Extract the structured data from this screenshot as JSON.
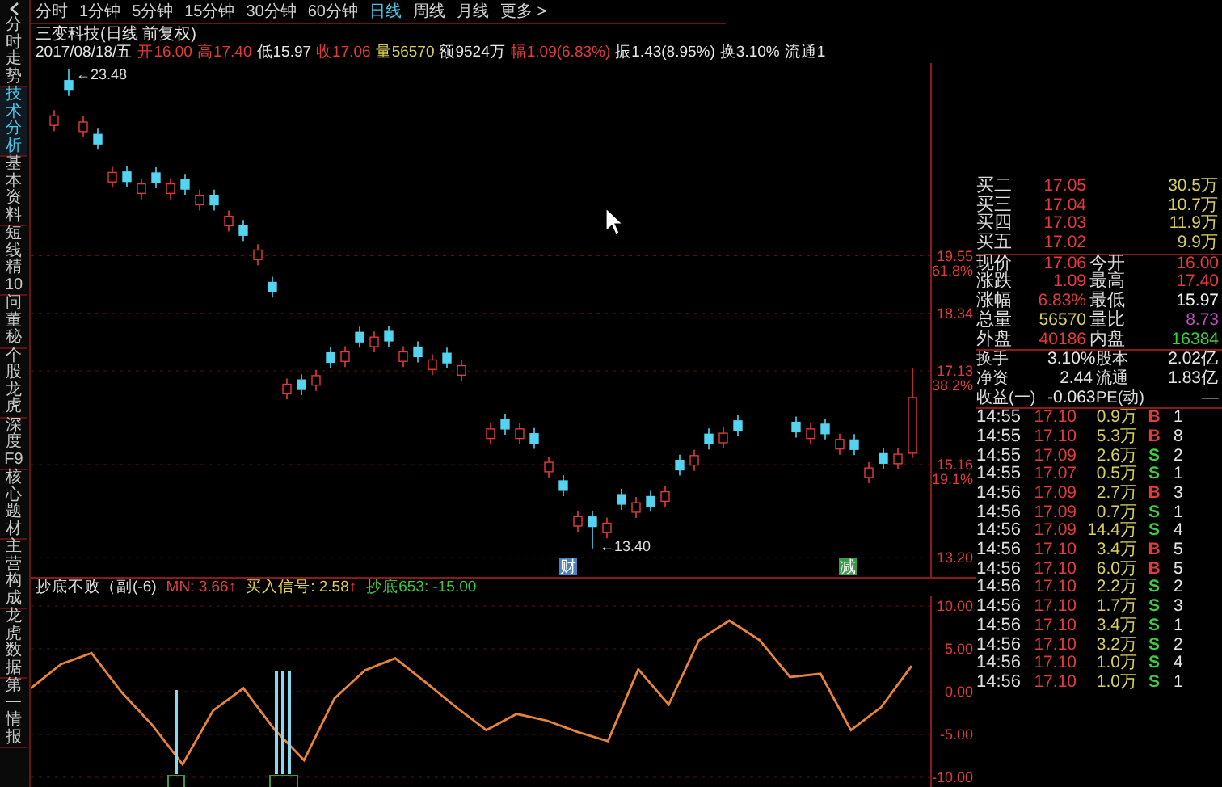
{
  "sidebar": [
    {
      "label": "分时走势",
      "selected": false
    },
    {
      "label": "技术分析",
      "selected": true
    },
    {
      "label": "基本资料",
      "selected": false
    },
    {
      "label": "短线精10",
      "selected": false
    },
    {
      "label": "问董秘",
      "selected": false
    },
    {
      "label": "个股龙虎",
      "selected": false
    },
    {
      "label": "深度F9",
      "selected": false
    },
    {
      "label": "核心题材",
      "selected": false
    },
    {
      "label": "主营构成",
      "selected": false
    },
    {
      "label": "龙虎数据",
      "selected": false
    },
    {
      "label": "第一情报",
      "selected": false
    }
  ],
  "periods": [
    {
      "label": "分时",
      "selected": false
    },
    {
      "label": "1分钟",
      "selected": false
    },
    {
      "label": "5分钟",
      "selected": false
    },
    {
      "label": "15分钟",
      "selected": false
    },
    {
      "label": "30分钟",
      "selected": false
    },
    {
      "label": "60分钟",
      "selected": false
    },
    {
      "label": "日线",
      "selected": true
    },
    {
      "label": "周线",
      "selected": false
    },
    {
      "label": "月线",
      "selected": false
    },
    {
      "label": "更多 >",
      "selected": false
    }
  ],
  "stock": {
    "title": "三变科技(日线 前复权)",
    "fields": [
      {
        "text": "2017/08/18/五",
        "color": "#e6e6e6"
      },
      {
        "text": "开16.00",
        "color": "#e23b3b"
      },
      {
        "text": "高17.40",
        "color": "#e23b3b"
      },
      {
        "text": "低15.97",
        "color": "#e6e6e6"
      },
      {
        "text": "收17.06",
        "color": "#e23b3b"
      },
      {
        "text": "量56570",
        "color": "#d8d05a"
      },
      {
        "text": "额9524万",
        "color": "#e6e6e6"
      },
      {
        "text": "幅1.09(6.83%)",
        "color": "#e23b3b"
      },
      {
        "text": "振1.43(8.95%)",
        "color": "#e6e6e6"
      },
      {
        "text": "换3.10%",
        "color": "#e6e6e6"
      },
      {
        "text": "流通1",
        "color": "#e6e6e6"
      }
    ]
  },
  "price_chart": {
    "fib_ratios": [
      "61.8%",
      "38.2%",
      "19.1%"
    ],
    "chart_data": {
      "type": "candlestick",
      "grid": true,
      "ylim": [
        12.8,
        23.6
      ],
      "yticks": [
        {
          "value": 19.55,
          "label": "19.55"
        },
        {
          "value": 18.34,
          "label": "18.34"
        },
        {
          "value": 17.13,
          "label": "17.13"
        },
        {
          "value": 15.16,
          "label": "15.16"
        },
        {
          "value": 13.2,
          "label": "13.20"
        }
      ],
      "ohlc": [
        [
          22.29,
          22.61,
          22.17,
          22.49
        ],
        [
          23.23,
          23.48,
          22.91,
          23.03
        ],
        [
          22.16,
          22.48,
          22.04,
          22.36
        ],
        [
          22.1,
          22.22,
          21.78,
          21.9
        ],
        [
          21.1,
          21.42,
          20.98,
          21.3
        ],
        [
          21.31,
          21.43,
          20.99,
          21.11
        ],
        [
          20.86,
          21.18,
          20.74,
          21.06
        ],
        [
          21.29,
          21.41,
          20.97,
          21.09
        ],
        [
          20.86,
          21.18,
          20.74,
          21.06
        ],
        [
          21.15,
          21.27,
          20.83,
          20.95
        ],
        [
          20.62,
          20.94,
          20.5,
          20.82
        ],
        [
          20.82,
          20.94,
          20.5,
          20.62
        ],
        [
          20.18,
          20.5,
          20.06,
          20.38
        ],
        [
          20.18,
          20.3,
          19.86,
          19.98
        ],
        [
          19.47,
          19.79,
          19.35,
          19.67
        ],
        [
          18.99,
          19.11,
          18.67,
          18.79
        ],
        [
          16.65,
          16.97,
          16.53,
          16.85
        ],
        [
          16.94,
          17.06,
          16.62,
          16.74
        ],
        [
          16.83,
          17.15,
          16.71,
          17.03
        ],
        [
          17.51,
          17.63,
          17.19,
          17.31
        ],
        [
          17.33,
          17.65,
          17.21,
          17.53
        ],
        [
          17.94,
          18.06,
          17.62,
          17.74
        ],
        [
          17.64,
          17.96,
          17.52,
          17.84
        ],
        [
          17.96,
          18.08,
          17.64,
          17.76
        ],
        [
          17.33,
          17.65,
          17.21,
          17.53
        ],
        [
          17.63,
          17.75,
          17.31,
          17.43
        ],
        [
          17.16,
          17.48,
          17.04,
          17.36
        ],
        [
          17.5,
          17.62,
          17.18,
          17.3
        ],
        [
          17.04,
          17.36,
          16.92,
          17.24
        ],
        null,
        [
          15.71,
          16.03,
          15.59,
          15.91
        ],
        [
          16.11,
          16.23,
          15.79,
          15.91
        ],
        [
          15.71,
          16.03,
          15.59,
          15.91
        ],
        [
          15.81,
          15.93,
          15.49,
          15.61
        ],
        [
          15.01,
          15.33,
          14.89,
          15.21
        ],
        [
          14.82,
          14.94,
          14.5,
          14.62
        ],
        [
          13.87,
          14.19,
          13.75,
          14.07
        ],
        [
          14.06,
          14.18,
          13.4,
          13.86
        ],
        [
          13.73,
          14.05,
          13.61,
          13.93
        ],
        [
          14.53,
          14.65,
          14.21,
          14.33
        ],
        [
          14.16,
          14.48,
          14.04,
          14.36
        ],
        [
          14.49,
          14.61,
          14.17,
          14.29
        ],
        [
          14.39,
          14.71,
          14.27,
          14.59
        ],
        [
          15.25,
          15.37,
          14.93,
          15.05
        ],
        [
          15.15,
          15.47,
          15.03,
          15.35
        ],
        [
          15.8,
          15.92,
          15.48,
          15.6
        ],
        [
          15.62,
          15.94,
          15.5,
          15.82
        ],
        [
          16.08,
          16.2,
          15.76,
          15.88
        ],
        null,
        null,
        null,
        [
          16.05,
          16.17,
          15.73,
          15.85
        ],
        [
          15.71,
          16.03,
          15.59,
          15.91
        ],
        [
          16.01,
          16.13,
          15.69,
          15.81
        ],
        [
          15.49,
          15.81,
          15.37,
          15.69
        ],
        [
          15.68,
          15.8,
          15.36,
          15.48
        ],
        [
          14.89,
          15.21,
          14.77,
          15.09
        ],
        [
          15.39,
          15.51,
          15.07,
          15.19
        ],
        [
          15.18,
          15.5,
          15.06,
          15.38
        ],
        [
          15.4,
          17.2,
          15.3,
          16.57
        ]
      ]
    }
  },
  "chart_labels": {
    "high": "←23.48",
    "low": "←13.40",
    "markers": [
      {
        "text": "财",
        "color": "#4a7fc0"
      },
      {
        "text": "减",
        "color": "#3a9a4a"
      }
    ]
  },
  "indicator": {
    "name": "抄底不败（副(-6)",
    "lines": [
      {
        "text": "MN: 3.66",
        "color": "#e04040",
        "arrow": "↑"
      },
      {
        "text": "买入信号: 2.58",
        "color": "#e0d050",
        "arrow": "↑"
      },
      {
        "text": "抄底653: -15.00",
        "color": "#3cc83c"
      }
    ],
    "chart_data": {
      "type": "line",
      "grid": true,
      "yticks": [
        {
          "value": 10,
          "label": "10.00"
        },
        {
          "value": 5,
          "label": "5.00"
        },
        {
          "value": 0,
          "label": "0.00"
        },
        {
          "value": -5,
          "label": "-5.00"
        },
        {
          "value": -10,
          "label": "-10.00"
        }
      ],
      "ylim": [
        -10,
        10
      ],
      "series": [
        {
          "color": "#e8843a",
          "values": [
            0.4,
            3.2,
            4.5,
            -0.1,
            -3.9,
            -8.5,
            -2.2,
            0.4,
            -4.3,
            -8.0,
            -0.8,
            2.5,
            3.9,
            1.1,
            -1.8,
            -4.5,
            -2.6,
            -3.4,
            -4.7,
            -5.8,
            2.6,
            -1.5,
            6.0,
            8.3,
            6.0,
            1.7,
            2.1,
            -4.5,
            -1.8,
            3.0
          ]
        }
      ]
    }
  },
  "order_book": [
    {
      "label": "买二",
      "price": "17.05",
      "volume": "30.5万"
    },
    {
      "label": "买三",
      "price": "17.04",
      "volume": "10.7万"
    },
    {
      "label": "买四",
      "price": "17.03",
      "volume": "11.9万"
    },
    {
      "label": "买五",
      "price": "17.02",
      "volume": "9.9万"
    }
  ],
  "quote": [
    [
      {
        "label": "现价",
        "value": "17.06",
        "color": "#e23b3b"
      },
      {
        "label": "今开",
        "value": "16.00",
        "color": "#e23b3b"
      }
    ],
    [
      {
        "label": "涨跌",
        "value": "1.09",
        "color": "#e23b3b"
      },
      {
        "label": "最高",
        "value": "17.40",
        "color": "#e23b3b"
      }
    ],
    [
      {
        "label": "涨幅",
        "value": "6.83%",
        "color": "#e23b3b"
      },
      {
        "label": "最低",
        "value": "15.97",
        "color": "#f0f0f0"
      }
    ],
    [
      {
        "label": "总量",
        "value": "56570",
        "color": "#d8d05a"
      },
      {
        "label": "量比",
        "value": "8.73",
        "color": "#c050c0"
      }
    ],
    [
      {
        "label": "外盘",
        "value": "40186",
        "color": "#e23b3b"
      },
      {
        "label": "内盘",
        "value": "16384",
        "color": "#3ccc3c"
      }
    ]
  ],
  "fundamentals": [
    [
      {
        "label": "换手",
        "value": "3.10%"
      },
      {
        "label": "股本",
        "value": "2.02亿"
      }
    ],
    [
      {
        "label": "净资",
        "value": "2.44"
      },
      {
        "label": "流通",
        "value": "1.83亿"
      }
    ],
    [
      {
        "label": "收益(一)",
        "value": "-0.063"
      },
      {
        "label": "PE(动)",
        "value": "—"
      }
    ]
  ],
  "trades": [
    {
      "time": "14:55",
      "price": "17.10",
      "volume": "0.9万",
      "side": "B",
      "kind": "buy",
      "count": "1"
    },
    {
      "time": "14:55",
      "price": "17.10",
      "volume": "5.3万",
      "side": "B",
      "kind": "buy",
      "count": "8"
    },
    {
      "time": "14:55",
      "price": "17.09",
      "volume": "2.6万",
      "side": "S",
      "kind": "sell",
      "count": "2"
    },
    {
      "time": "14:55",
      "price": "17.07",
      "volume": "0.5万",
      "side": "S",
      "kind": "sell",
      "count": "1"
    },
    {
      "time": "14:56",
      "price": "17.09",
      "volume": "2.7万",
      "side": "B",
      "kind": "buy",
      "count": "3"
    },
    {
      "time": "14:56",
      "price": "17.09",
      "volume": "0.7万",
      "side": "S",
      "kind": "sell",
      "count": "1"
    },
    {
      "time": "14:56",
      "price": "17.09",
      "volume": "14.4万",
      "side": "S",
      "kind": "sell",
      "count": "4"
    },
    {
      "time": "14:56",
      "price": "17.10",
      "volume": "3.4万",
      "side": "B",
      "kind": "buy",
      "count": "5"
    },
    {
      "time": "14:56",
      "price": "17.10",
      "volume": "6.0万",
      "side": "B",
      "kind": "buy",
      "count": "5"
    },
    {
      "time": "14:56",
      "price": "17.10",
      "volume": "2.2万",
      "side": "S",
      "kind": "sell",
      "count": "2"
    },
    {
      "time": "14:56",
      "price": "17.10",
      "volume": "1.7万",
      "side": "S",
      "kind": "sell",
      "count": "3"
    },
    {
      "time": "14:56",
      "price": "17.10",
      "volume": "3.4万",
      "side": "S",
      "kind": "sell",
      "count": "1"
    },
    {
      "time": "14:56",
      "price": "17.10",
      "volume": "3.2万",
      "side": "S",
      "kind": "sell",
      "count": "2"
    },
    {
      "time": "14:56",
      "price": "17.10",
      "volume": "1.0万",
      "side": "S",
      "kind": "sell",
      "count": "4"
    },
    {
      "time": "14:56",
      "price": "17.10",
      "volume": "1.0万",
      "side": "S",
      "kind": "sell",
      "count": "1"
    }
  ]
}
